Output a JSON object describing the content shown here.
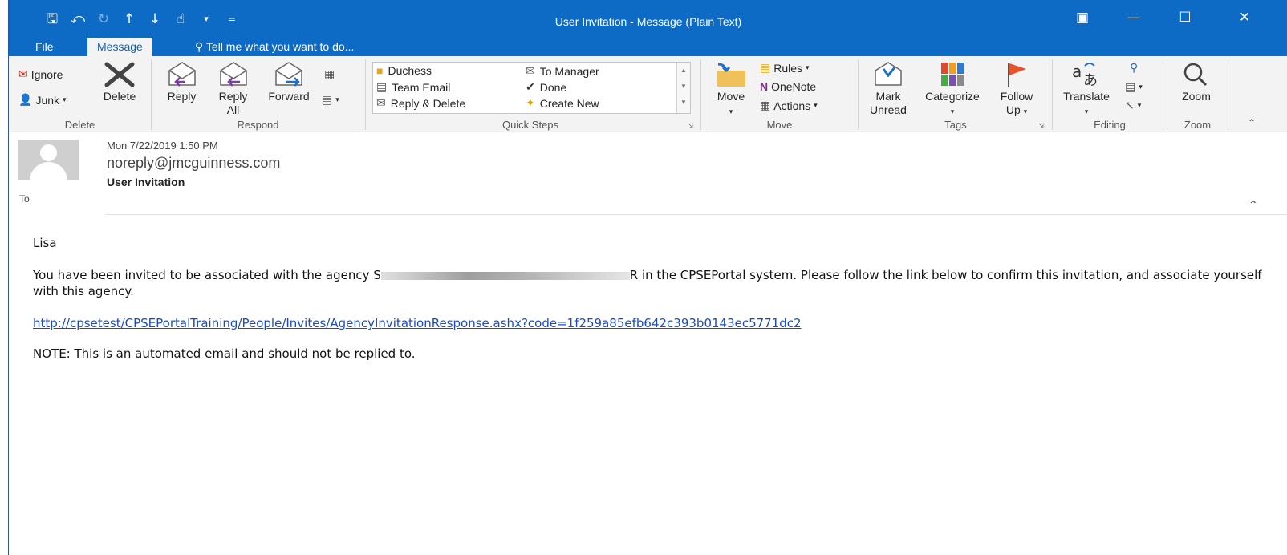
{
  "window": {
    "title": "User Invitation - Message (Plain Text)"
  },
  "tabs": {
    "file": "File",
    "message": "Message",
    "tell_me": "Tell me what you want to do..."
  },
  "ribbon": {
    "delete_group": {
      "label": "Delete",
      "ignore": "Ignore",
      "junk": "Junk",
      "delete": "Delete"
    },
    "respond_group": {
      "label": "Respond",
      "reply": "Reply",
      "reply_all_1": "Reply",
      "reply_all_2": "All",
      "forward": "Forward"
    },
    "quick_steps": {
      "label": "Quick Steps",
      "items": [
        "Duchess",
        "Team Email",
        "Reply & Delete",
        "To Manager",
        "Done",
        "Create New"
      ]
    },
    "move_group": {
      "label": "Move",
      "move": "Move",
      "rules": "Rules",
      "onenote": "OneNote",
      "actions": "Actions"
    },
    "tags_group": {
      "label": "Tags",
      "mark_unread_1": "Mark",
      "mark_unread_2": "Unread",
      "categorize": "Categorize",
      "follow_up_1": "Follow",
      "follow_up_2": "Up"
    },
    "editing_group": {
      "label": "Editing",
      "translate": "Translate"
    },
    "zoom_group": {
      "label": "Zoom",
      "zoom": "Zoom"
    }
  },
  "message": {
    "date": "Mon 7/22/2019 1:50 PM",
    "from": "noreply@jmcguinness.com",
    "subject": "User Invitation",
    "to_label": "To",
    "greeting": "Lisa",
    "body_part1": "You have been invited to be associated with the agency S",
    "body_part2": "R in the CPSEPortal system. Please follow the link below to confirm this invitation, and associate yourself with this agency.",
    "link": "http://cpsetest/CPSEPortalTraining/People/Invites/AgencyInvitationResponse.ashx?code=1f259a85efb642c393b0143ec5771dc2",
    "note": "NOTE: This is an automated email and should not be replied to."
  },
  "colors": {
    "titlebar": "#0d6bc5",
    "ribbon": "#f3f3f3",
    "link": "#1a49c9"
  }
}
